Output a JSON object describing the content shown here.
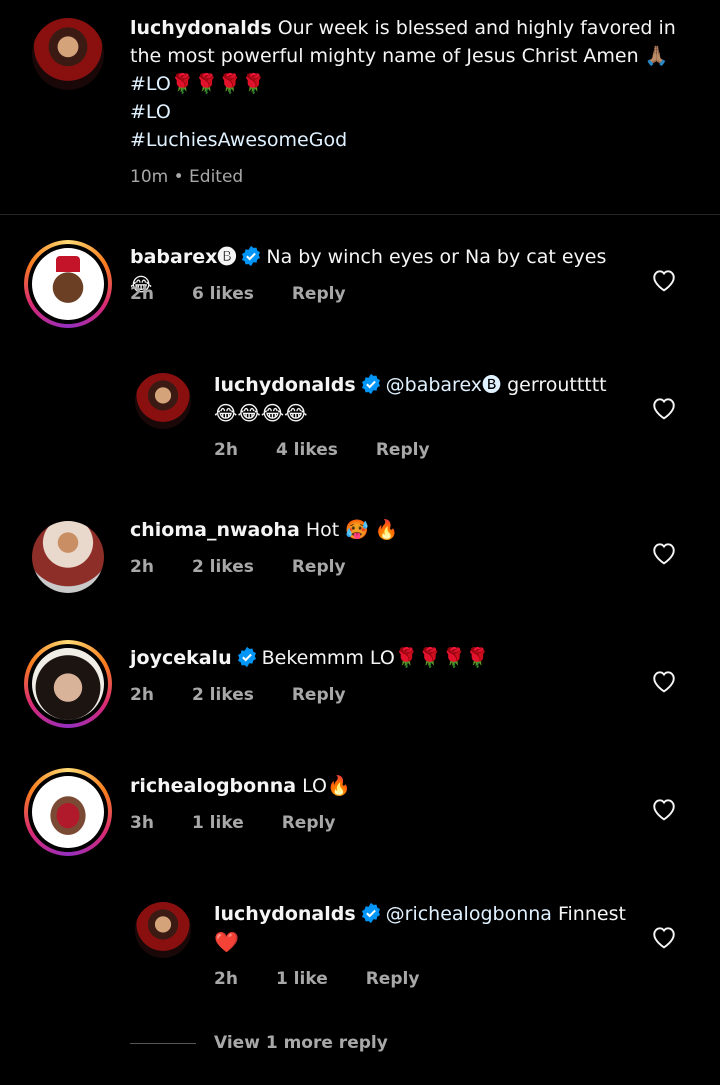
{
  "caption": {
    "username": "luchydonalds",
    "text": "Our week is blessed and highly favored in the most powerful mighty name of Jesus Christ Amen 🙏🏽",
    "hashtags": [
      "#LO🌹🌹🌹🌹",
      "#LO",
      "#LuchiesAwesomeGod"
    ],
    "time": "10m",
    "edited": "Edited"
  },
  "comments": [
    {
      "username": "babarex🅑",
      "text": "Na by winch eyes or Na by cat eyes 😂",
      "time": "2h",
      "likes": "6 likes",
      "reply": "Reply",
      "verified": true
    },
    {
      "username": "luchydonalds",
      "mention": "@babarex🅑",
      "text": "gerrouttttt",
      "emoji": "😂😂😂😂",
      "time": "2h",
      "likes": "4 likes",
      "reply": "Reply",
      "verified": true
    },
    {
      "username": "chioma_nwaoha",
      "text": "Hot 🥵 🔥",
      "time": "2h",
      "likes": "2 likes",
      "reply": "Reply",
      "verified": false
    },
    {
      "username": "joycekalu",
      "text": "Bekemmm LO🌹🌹🌹🌹",
      "time": "2h",
      "likes": "2 likes",
      "reply": "Reply",
      "verified": true
    },
    {
      "username": "richealogbonna",
      "text": "LO🔥",
      "time": "3h",
      "likes": "1 like",
      "reply": "Reply",
      "verified": false
    },
    {
      "username": "luchydonalds",
      "mention": "@richealogbonna",
      "text": "Finnest",
      "emoji": "❤️",
      "time": "2h",
      "likes": "1 like",
      "reply": "Reply",
      "verified": true
    }
  ],
  "view_more": "View 1 more reply",
  "colors": {
    "background": "#000000",
    "verified": "#0095f6",
    "muted": "#a8a8a8",
    "heart": "#f5f5f5"
  }
}
